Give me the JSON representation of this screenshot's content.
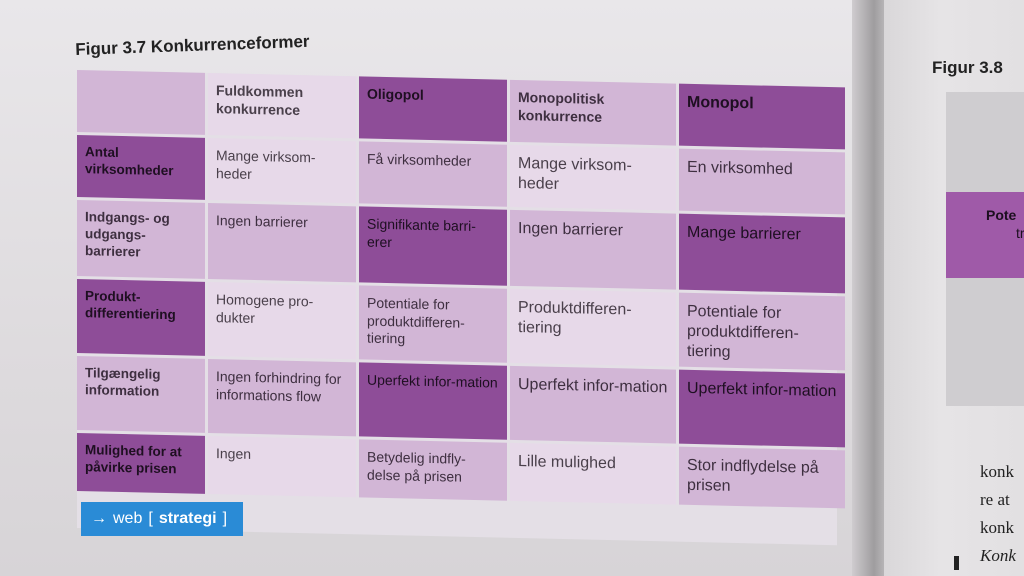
{
  "figure": {
    "title": "Figur 3.7 Konkurrenceformer",
    "columns": [
      "",
      "Fuldkommen konkurrence",
      "Oligopol",
      "Monopolitisk konkurrence",
      "Monopol"
    ],
    "rows": [
      {
        "label": "Antal virksomheder",
        "cells": [
          "Mange virksom-heder",
          "Få virksomheder",
          "Mange virksom-heder",
          "En virksomhed"
        ]
      },
      {
        "label": "Indgangs- og udgangs-barrierer",
        "cells": [
          "Ingen barrierer",
          "Signifikante barri-erer",
          "Ingen barrierer",
          "Mange barrierer"
        ]
      },
      {
        "label": "Produkt-differentiering",
        "cells": [
          "Homogene pro-dukter",
          "Potentiale for produktdifferen-tiering",
          "Produktdifferen-tiering",
          "Potentiale for produktdifferen-tiering"
        ]
      },
      {
        "label": "Tilgængelig information",
        "cells": [
          "Ingen forhindring for informations flow",
          "Uperfekt infor-mation",
          "Uperfekt infor-mation",
          "Uperfekt infor-mation"
        ]
      },
      {
        "label": "Mulighed for at påvirke prisen",
        "cells": [
          "Ingen",
          "Betydelig indfly-delse på prisen",
          "Lille mulighed",
          "Stor indflydelse på prisen"
        ]
      }
    ]
  },
  "web_button": {
    "arrow": "→",
    "prefix": "web",
    "bracket_open": "[",
    "label": "strategi",
    "bracket_close": "]"
  },
  "right_page": {
    "title": "Figur 3.8",
    "box_text_1": "Pote",
    "box_text_2": "tr",
    "text_lines": [
      "konk",
      "re at",
      "konk"
    ],
    "italic_line": "Konk"
  }
}
